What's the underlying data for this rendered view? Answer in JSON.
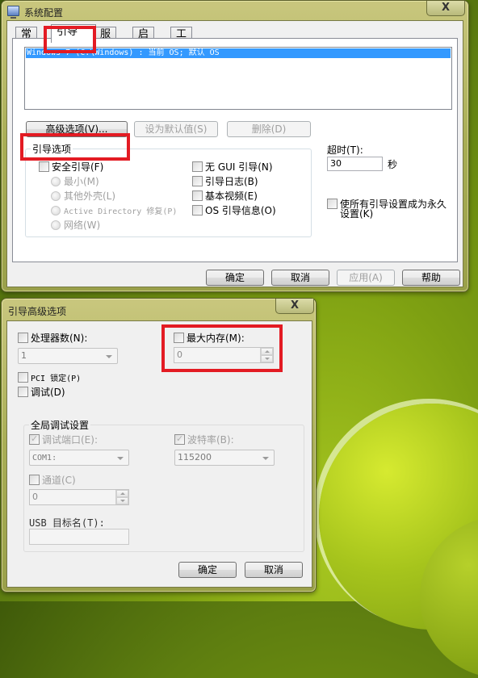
{
  "sys_config": {
    "title": "系统配置",
    "close_label": "X",
    "tabs": [
      {
        "label": "常规",
        "active": false
      },
      {
        "label": "引导",
        "active": true
      },
      {
        "label": "服务",
        "active": false
      },
      {
        "label": "启动",
        "active": false
      },
      {
        "label": "工具",
        "active": false
      }
    ],
    "boot_entries": [
      "Windows 7 (C:\\Windows) : 当前 OS; 默认 OS"
    ],
    "buttons": {
      "advanced": "高级选项(V)...",
      "set_default": "设为默认值(S)",
      "delete": "删除(D)"
    },
    "boot_options": {
      "label": "引导选项",
      "safe_boot": {
        "label": "安全引导(F)",
        "checked": false
      },
      "radios": [
        {
          "label": "最小(M)",
          "enabled": false
        },
        {
          "label": "其他外壳(L)",
          "enabled": false
        },
        {
          "label": "Active Directory 修复(P)",
          "enabled": false
        },
        {
          "label": "网络(W)",
          "enabled": false
        }
      ],
      "right_checks": [
        {
          "label": "无 GUI 引导(N)",
          "checked": false
        },
        {
          "label": "引导日志(B)",
          "checked": false
        },
        {
          "label": "基本视频(E)",
          "checked": false
        },
        {
          "label": "OS 引导信息(O)",
          "checked": false
        }
      ]
    },
    "timeout": {
      "label": "超时(T):",
      "value": "30",
      "unit": "秒"
    },
    "make_permanent": {
      "label_line1": "使所有引导设置成为永久",
      "label_line2": "设置(K)",
      "checked": false
    },
    "footer": {
      "ok": "确定",
      "cancel": "取消",
      "apply": "应用(A)",
      "help": "帮助"
    }
  },
  "advanced": {
    "title": "引导高级选项",
    "close_label": "X",
    "num_processors": {
      "label": "处理器数(N):",
      "checked": false,
      "value": "1"
    },
    "max_memory": {
      "label": "最大内存(M):",
      "checked": false,
      "value": "0"
    },
    "pci_lock": {
      "label": "PCI 锁定(P)",
      "checked": false
    },
    "debug": {
      "label": "调试(D)",
      "checked": false
    },
    "global_debug": {
      "label": "全局调试设置",
      "debug_port": {
        "label": "调试端口(E):",
        "checked": true,
        "value": "COM1:"
      },
      "baud_rate": {
        "label": "波特率(B):",
        "checked": true,
        "value": "115200"
      },
      "channel": {
        "label": "通道(C)",
        "checked": false,
        "value": "0"
      },
      "usb_target": {
        "label": "USB 目标名(T):",
        "value": ""
      }
    },
    "footer": {
      "ok": "确定",
      "cancel": "取消"
    }
  },
  "annotations": {
    "highlight_color": "#e31b23"
  }
}
